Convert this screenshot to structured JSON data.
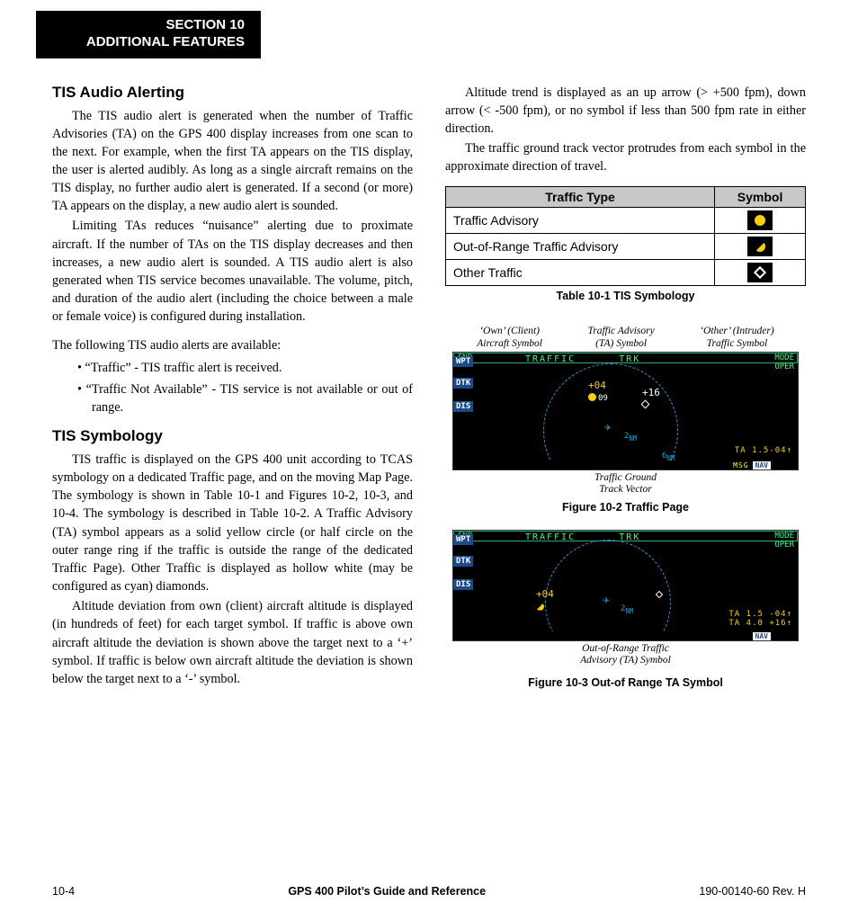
{
  "section_tab": {
    "line1": "SECTION 10",
    "line2": "ADDITIONAL FEATURES"
  },
  "col_left": {
    "h1": "TIS Audio Alerting",
    "p1": "The TIS audio alert is generated when the number of Traffic Advisories (TA) on the GPS 400 display increases from one scan to the next.  For example, when the first TA appears on the TIS display, the user is alerted audibly.  As long as a single aircraft remains on the TIS display, no further audio alert is generated.  If a second (or more) TA appears on the display, a new audio alert is sounded.",
    "p2": "Limiting TAs reduces “nuisance” alerting due to proximate aircraft.  If the number of TAs on the TIS display decreases and then increases, a new audio alert is sounded.  A TIS audio alert is also generated when TIS service becomes unavailable.  The volume, pitch, and duration of the audio alert (including the choice between a male or female voice) is configured during installation.",
    "p3": "The following TIS audio alerts are available:",
    "b1": "“Traffic” - TIS traffic alert is received.",
    "b2": "“Traffic Not Available” - TIS service is not available or out of range.",
    "h2": "TIS Symbology",
    "p4": "TIS traffic is displayed on the GPS 400 unit according to TCAS symbology on a dedicated Traffic page, and on the moving Map Page.  The symbology is shown in Table 10-1 and Figures 10-2, 10-3, and 10-4.  The symbology is described in Table 10-2.  A Traffic Advisory (TA) symbol appears as a solid yellow circle (or half circle on the outer range ring if the traffic is outside the range of the dedicated Traffic Page).  Other Traffic is displayed as hollow white (may be configured as cyan) diamonds.",
    "p5": "Altitude deviation from own (client) aircraft altitude is displayed (in hundreds of feet) for each target symbol.  If traffic is above own aircraft altitude the deviation is shown above the target next to a ‘+’ symbol.  If traffic is below own aircraft altitude the deviation is shown below the target next to a ‘-’ symbol."
  },
  "col_right": {
    "p1": "Altitude trend is displayed as an up arrow (> +500 fpm), down arrow (< -500 fpm), or no symbol if less than 500 fpm rate in either direction.",
    "p2": "The traffic ground track vector protrudes from each symbol in the approximate direction of travel.",
    "table": {
      "th1": "Traffic Type",
      "th2": "Symbol",
      "r1": "Traffic Advisory",
      "r2": "Out-of-Range Traffic Advisory",
      "r3": "Other Traffic",
      "caption": "Table 10-1  TIS Symbology"
    },
    "fig1": {
      "labels_top": {
        "a": "‘Own’ (Client)\nAircraft Symbol",
        "b": "Traffic Advisory\n(TA) Symbol",
        "c": "‘Other’ (Intruder)\nTraffic Symbol"
      },
      "screen": {
        "wpt": "WPT",
        "dtk": "DTK",
        "dis": "DIS",
        "enr": "ENR",
        "title": "TRAFFIC",
        "trk": "TRK",
        "mode": "MODE\nOPER",
        "ta_val": "+04",
        "ta_hdg": "09",
        "other_val": "+16",
        "r2": "2",
        "r2u": "NM",
        "r6": "6",
        "r6u": "NM",
        "ta_text": "TA 1.5-04↑",
        "msg": "MSG",
        "nav": "NAV"
      },
      "label_bot": "Traffic Ground\nTrack Vector",
      "caption": "Figure 10-2  Traffic Page"
    },
    "fig2": {
      "screen": {
        "wpt": "WPT",
        "dtk": "DTK",
        "dis": "DIS",
        "enr": "ENR",
        "title": "TRAFFIC",
        "trk": "TRK",
        "mode": "MODE\nOPER",
        "ta_val": "+04",
        "r2": "2",
        "r2u": "NM",
        "ta_text1": "TA 1.5 -04↑",
        "ta_text2": "TA 4.0 +16↑",
        "nav": "NAV"
      },
      "label_bot": "Out-of-Range Traffic\nAdvisory (TA) Symbol",
      "caption": "Figure 10-3  Out-of Range TA Symbol"
    }
  },
  "footer": {
    "left": "10-4",
    "center": "GPS 400 Pilot’s Guide and Reference",
    "right": "190-00140-60  Rev. H"
  }
}
